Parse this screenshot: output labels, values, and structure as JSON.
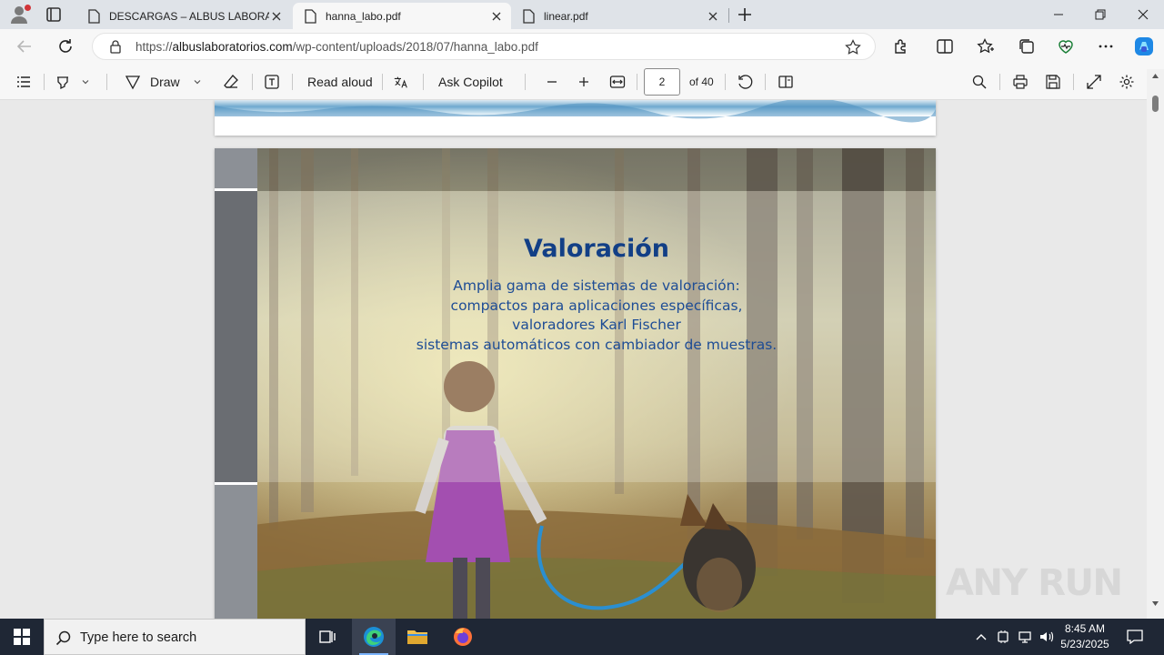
{
  "browser": {
    "tabs": [
      {
        "title": "DESCARGAS – ALBUS LABORATORIOS",
        "active": false
      },
      {
        "title": "hanna_labo.pdf",
        "active": true
      },
      {
        "title": "linear.pdf",
        "active": false
      }
    ],
    "address": {
      "scheme": "https://",
      "host": "albuslaboratorios.com",
      "path": "/wp-content/uploads/2018/07/hanna_labo.pdf"
    }
  },
  "pdf_toolbar": {
    "draw_label": "Draw",
    "read_aloud_label": "Read aloud",
    "ask_copilot_label": "Ask Copilot",
    "page_current": "2",
    "page_total_label": "of 40"
  },
  "document": {
    "heading": "Valoración",
    "lines": [
      "Amplia gama de sistemas de valoración:",
      "compactos para aplicaciones específicas,",
      "valoradores Karl Fischer",
      "sistemas automáticos con cambiador de muestras."
    ]
  },
  "watermark": "ANY RUN",
  "taskbar": {
    "search_placeholder": "Type here to search",
    "time": "8:45 AM",
    "date": "5/23/2025"
  },
  "colors": {
    "heading": "#123f86",
    "body_text": "#1d4c95",
    "taskbar": "#1f2735",
    "accent": "#0078d4"
  },
  "icons": [
    "profile-icon",
    "tab-actions-icon",
    "document-icon",
    "close-icon",
    "new-tab-icon",
    "minimize-icon",
    "restore-icon",
    "back-icon",
    "refresh-icon",
    "lock-icon",
    "favorite-star-icon",
    "extensions-icon",
    "split-screen-icon",
    "favorites-icon",
    "collections-icon",
    "performance-icon",
    "more-icon",
    "copilot-icon",
    "contents-icon",
    "highlight-icon",
    "draw-icon",
    "eraser-icon",
    "text-icon",
    "translate-icon",
    "zoom-out-icon",
    "zoom-in-icon",
    "fit-width-icon",
    "rotate-icon",
    "page-view-icon",
    "search-icon",
    "print-icon",
    "save-icon",
    "fullscreen-icon",
    "settings-icon",
    "windows-start-icon",
    "task-view-icon",
    "edge-icon",
    "file-explorer-icon",
    "firefox-icon",
    "chevron-up-icon",
    "network-icon",
    "volume-icon",
    "notifications-icon"
  ]
}
